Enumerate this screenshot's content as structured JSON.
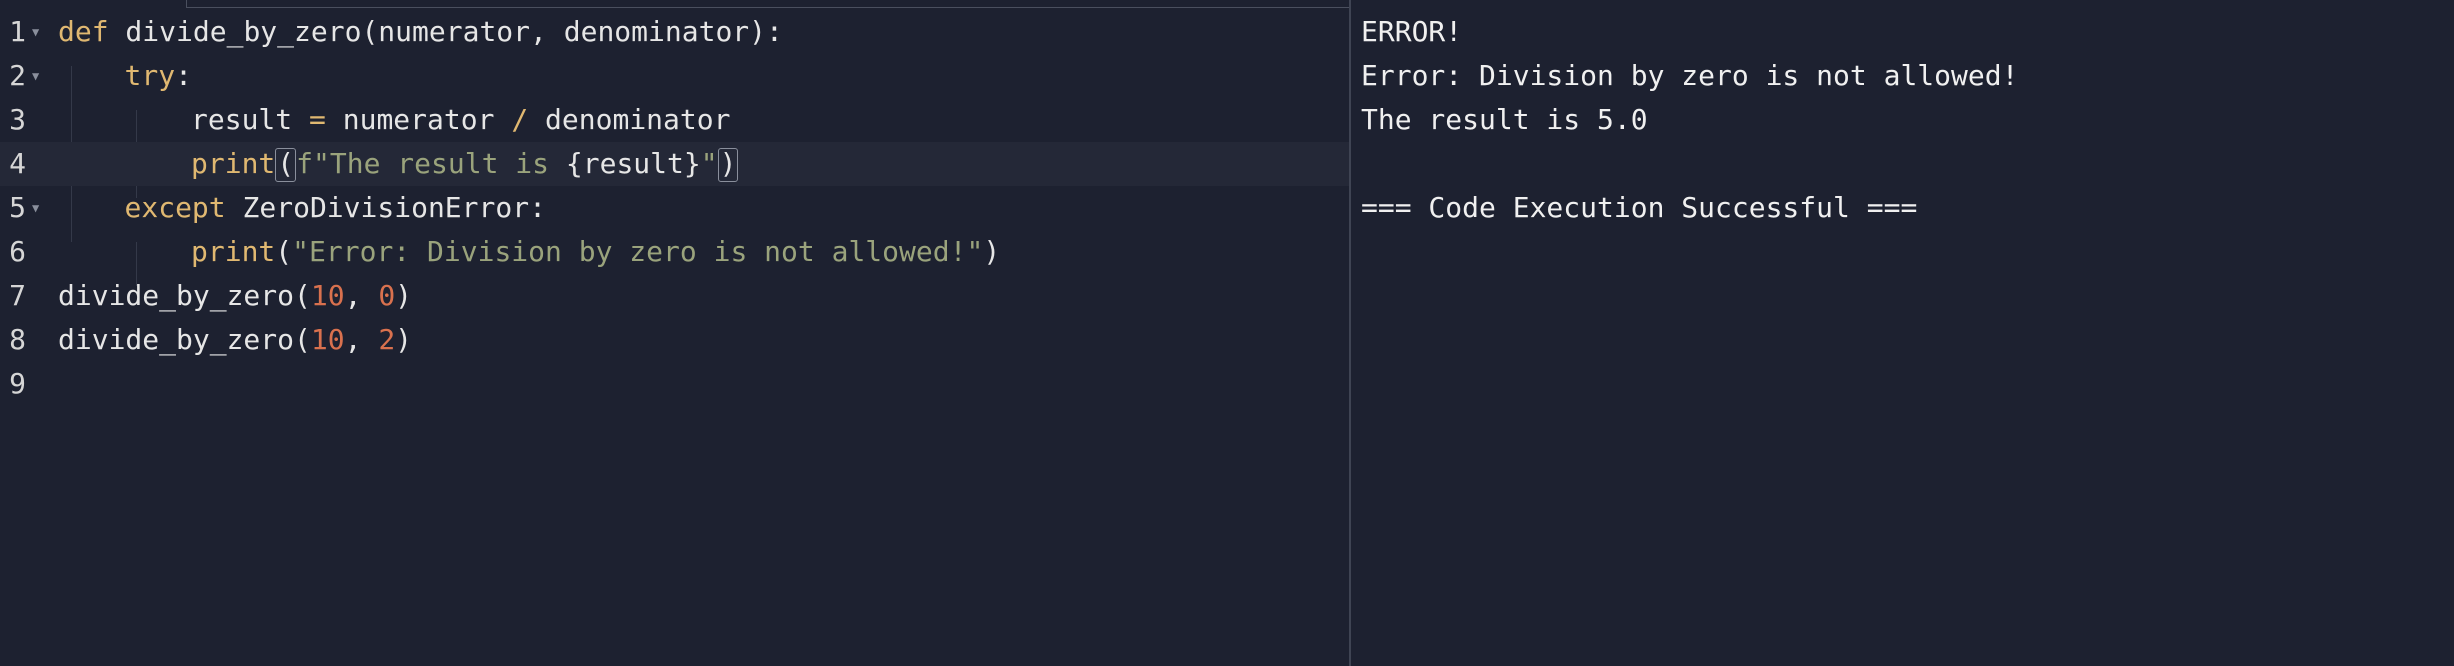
{
  "editor": {
    "line_numbers": [
      "1",
      "2",
      "3",
      "4",
      "5",
      "6",
      "7",
      "8",
      "9"
    ],
    "lines": [
      {
        "tokens": [
          {
            "t": "def",
            "c": "kw"
          },
          {
            "t": " divide_by_zero(numerator, denominator):",
            "c": "fn"
          }
        ]
      },
      {
        "tokens": [
          {
            "t": "try",
            "c": "kw"
          },
          {
            "t": ":",
            "c": "fn"
          }
        ]
      },
      {
        "tokens": [
          {
            "t": "result ",
            "c": "fn"
          },
          {
            "t": "=",
            "c": "op"
          },
          {
            "t": " numerator ",
            "c": "fn"
          },
          {
            "t": "/",
            "c": "op"
          },
          {
            "t": " denominator",
            "c": "fn"
          }
        ]
      },
      {
        "tokens": [
          {
            "t": "print",
            "c": "kw"
          },
          {
            "t": "(",
            "c": "fn",
            "box": true
          },
          {
            "t": "f\"The result is ",
            "c": "str"
          },
          {
            "t": "{result}",
            "c": "fn"
          },
          {
            "t": "\"",
            "c": "str"
          },
          {
            "t": ")",
            "c": "fn",
            "box": true
          }
        ]
      },
      {
        "tokens": [
          {
            "t": "except",
            "c": "kw"
          },
          {
            "t": " ZeroDivisionError:",
            "c": "fn"
          }
        ]
      },
      {
        "tokens": [
          {
            "t": "print",
            "c": "kw"
          },
          {
            "t": "(",
            "c": "fn"
          },
          {
            "t": "\"Error: Division by zero is not allowed!\"",
            "c": "str"
          },
          {
            "t": ")",
            "c": "fn"
          }
        ]
      },
      {
        "tokens": [
          {
            "t": "divide_by_zero(",
            "c": "fn"
          },
          {
            "t": "10",
            "c": "num"
          },
          {
            "t": ", ",
            "c": "fn"
          },
          {
            "t": "0",
            "c": "num"
          },
          {
            "t": ")",
            "c": "fn"
          }
        ]
      },
      {
        "tokens": [
          {
            "t": "divide_by_zero(",
            "c": "fn"
          },
          {
            "t": "10",
            "c": "num"
          },
          {
            "t": ", ",
            "c": "fn"
          },
          {
            "t": "2",
            "c": "num"
          },
          {
            "t": ")",
            "c": "fn"
          }
        ]
      },
      {
        "tokens": []
      }
    ]
  },
  "output": {
    "lines": [
      "ERROR!",
      "Error: Division by zero is not allowed!",
      "The result is 5.0",
      "",
      "=== Code Execution Successful ==="
    ]
  }
}
